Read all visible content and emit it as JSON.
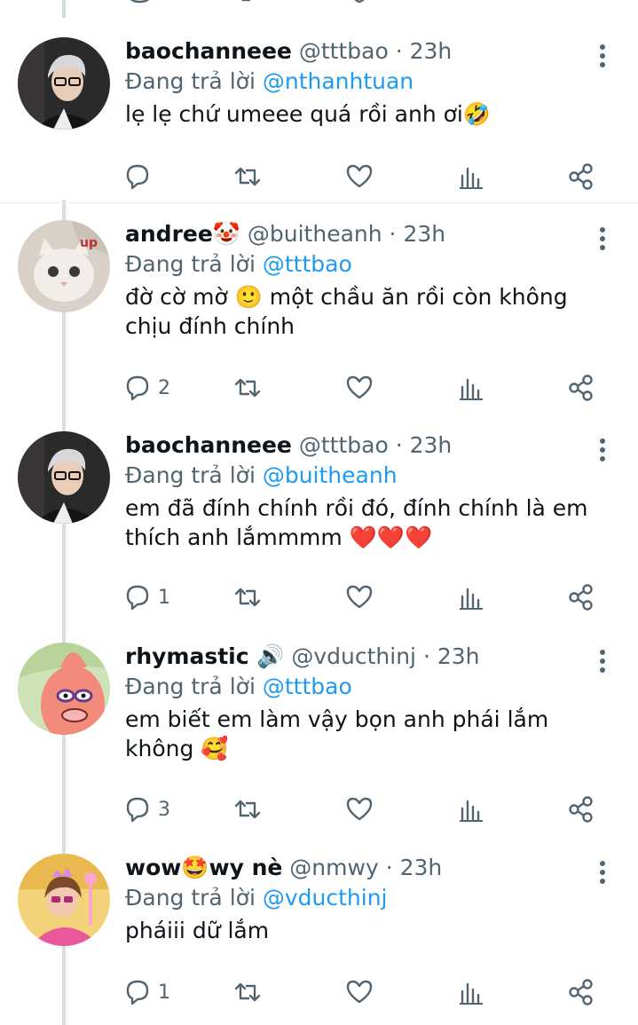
{
  "tweets": [
    {
      "display_name": "baochanneee",
      "name_emoji": "",
      "handle": "@tttbao",
      "separator": "·",
      "time": "23h",
      "replying_prefix": "Đang trả lời",
      "replying_to": "@nthanhtuan",
      "text": "lẹ lẹ chứ umeee quá rồi anh ơi🤣",
      "reply_count": "",
      "avatar": "avatar-baochanneee"
    },
    {
      "display_name": "andree🤡",
      "name_emoji": "",
      "handle": "@buitheanh",
      "separator": "·",
      "time": "23h",
      "replying_prefix": "Đang trả lời",
      "replying_to": "@tttbao",
      "text": "đờ cờ mờ 🙂 một chầu ăn rồi còn không chịu đính chính",
      "reply_count": "2",
      "avatar": "avatar-andree"
    },
    {
      "display_name": "baochanneee",
      "name_emoji": "",
      "handle": "@tttbao",
      "separator": "·",
      "time": "23h",
      "replying_prefix": "Đang trả lời",
      "replying_to": "@buitheanh",
      "text": "em đã đính chính rồi đó, đính chính là em thích anh lắmmmm ❤️❤️❤️",
      "reply_count": "1",
      "avatar": "avatar-baochanneee"
    },
    {
      "display_name": "rhymastic 🔊",
      "name_emoji": "",
      "handle": "@vducthinj",
      "separator": "·",
      "time": "23h",
      "replying_prefix": "Đang trả lời",
      "replying_to": "@tttbao",
      "text": "em biết em làm vậy bọn anh phái lắm không 🥰",
      "reply_count": "3",
      "avatar": "avatar-rhymastic"
    },
    {
      "display_name": "wow🤩wy nè",
      "name_emoji": "",
      "handle": "@nmwy",
      "separator": "·",
      "time": "23h",
      "replying_prefix": "Đang trả lời",
      "replying_to": "@vducthinj",
      "text": "pháiii dữ lắm",
      "reply_count": "1",
      "avatar": "avatar-wowwy"
    }
  ],
  "icons": {
    "reply": "reply-icon",
    "retweet": "retweet-icon",
    "like": "heart-icon",
    "views": "views-icon",
    "share": "share-icon",
    "more": "more-icon"
  },
  "colors": {
    "text": "#0f1419",
    "secondary": "#536471",
    "link": "#1d9bf0",
    "thread_line": "#cfd9de"
  }
}
